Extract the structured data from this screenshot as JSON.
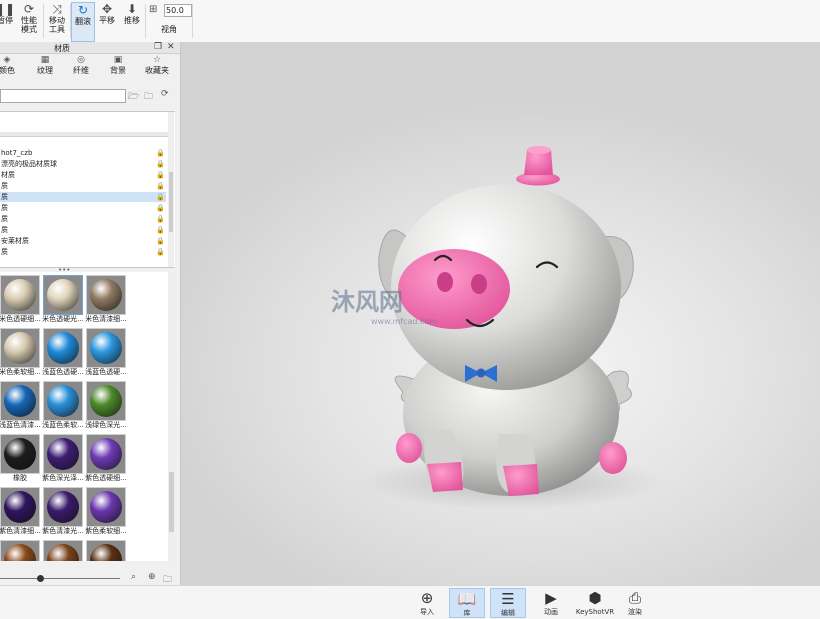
{
  "toolbar": {
    "buttons": [
      {
        "label": "暂停",
        "icon": "pause-icon"
      },
      {
        "label": "性能\n模式",
        "icon": "performance-mode-icon"
      },
      {
        "label": "移动\n工具",
        "icon": "move-tool-icon"
      },
      {
        "label": "翻滚",
        "icon": "tumble-icon"
      },
      {
        "label": "平移",
        "icon": "pan-icon"
      },
      {
        "label": "推移",
        "icon": "dolly-icon"
      }
    ],
    "angle_value": "50.0",
    "angle_label": "视角"
  },
  "panel": {
    "title": "材质",
    "tabs": [
      {
        "label": "颜色",
        "icon": "paint-bucket-icon"
      },
      {
        "label": "纹理",
        "icon": "texture-icon"
      },
      {
        "label": "纤维",
        "icon": "fiber-icon"
      },
      {
        "label": "背景",
        "icon": "background-icon"
      },
      {
        "label": "收藏夹",
        "icon": "star-icon"
      }
    ],
    "search_placeholder": "",
    "tree_rows": [
      {
        "label": "hot7_czb",
        "selected": false
      },
      {
        "label": "漂亮的极品材质球",
        "selected": false
      },
      {
        "label": "材质",
        "selected": false
      },
      {
        "label": "质",
        "selected": false
      },
      {
        "label": "质",
        "selected": true
      },
      {
        "label": "质",
        "selected": false
      },
      {
        "label": "质",
        "selected": false
      },
      {
        "label": "质",
        "selected": false
      },
      {
        "label": "安莱材质",
        "selected": false
      },
      {
        "label": "质",
        "selected": false
      }
    ],
    "splitter": "•••",
    "materials": [
      {
        "label": "米色透硬细...",
        "color": "#d9cdb4",
        "selected": false
      },
      {
        "label": "米色透硬光...",
        "color": "#e0d4bc",
        "selected": true
      },
      {
        "label": "米色清漆细...",
        "color": "#8f7a60",
        "selected": false
      },
      {
        "label": "米色柔软细...",
        "color": "#d6c9ae",
        "selected": false
      },
      {
        "label": "浅蓝色透硬...",
        "color": "#1e8ad9",
        "selected": false
      },
      {
        "label": "浅蓝色透硬...",
        "color": "#2a97e0",
        "selected": false
      },
      {
        "label": "浅蓝色清漆...",
        "color": "#1566b8",
        "selected": false
      },
      {
        "label": "浅蓝色柔软...",
        "color": "#2a8fd6",
        "selected": false
      },
      {
        "label": "浅绿色深光...",
        "color": "#4d8a2a",
        "selected": false
      },
      {
        "label": "橡胶",
        "color": "#1c1c1c",
        "selected": false
      },
      {
        "label": "紫色深光泽...",
        "color": "#3e1c74",
        "selected": false
      },
      {
        "label": "紫色透硬细...",
        "color": "#6e3bb5",
        "selected": false
      },
      {
        "label": "紫色清漆细...",
        "color": "#2e145e",
        "selected": false
      },
      {
        "label": "紫色清漆光...",
        "color": "#3a1a6c",
        "selected": false
      },
      {
        "label": "紫色柔软细...",
        "color": "#6a36ae",
        "selected": false
      },
      {
        "label": "",
        "color": "#8a4a1a",
        "selected": false
      },
      {
        "label": "",
        "color": "#7a4218",
        "selected": false
      },
      {
        "label": "",
        "color": "#5a3012",
        "selected": false
      }
    ],
    "slider_value": 0.33
  },
  "viewport": {
    "watermark_text": "沐风网",
    "watermark_url": "www.mfcad.com"
  },
  "bottombar": {
    "buttons": [
      {
        "label": "导入",
        "icon": "import-icon",
        "active": false
      },
      {
        "label": "库",
        "icon": "library-icon",
        "active": true
      },
      {
        "label": "编辑",
        "icon": "edit-icon",
        "active": true
      },
      {
        "label": "动画",
        "icon": "animation-icon",
        "active": false
      },
      {
        "label": "KeyShotVR",
        "icon": "keyshotvr-icon",
        "active": false
      },
      {
        "label": "渲染",
        "icon": "render-icon",
        "active": false
      }
    ]
  }
}
